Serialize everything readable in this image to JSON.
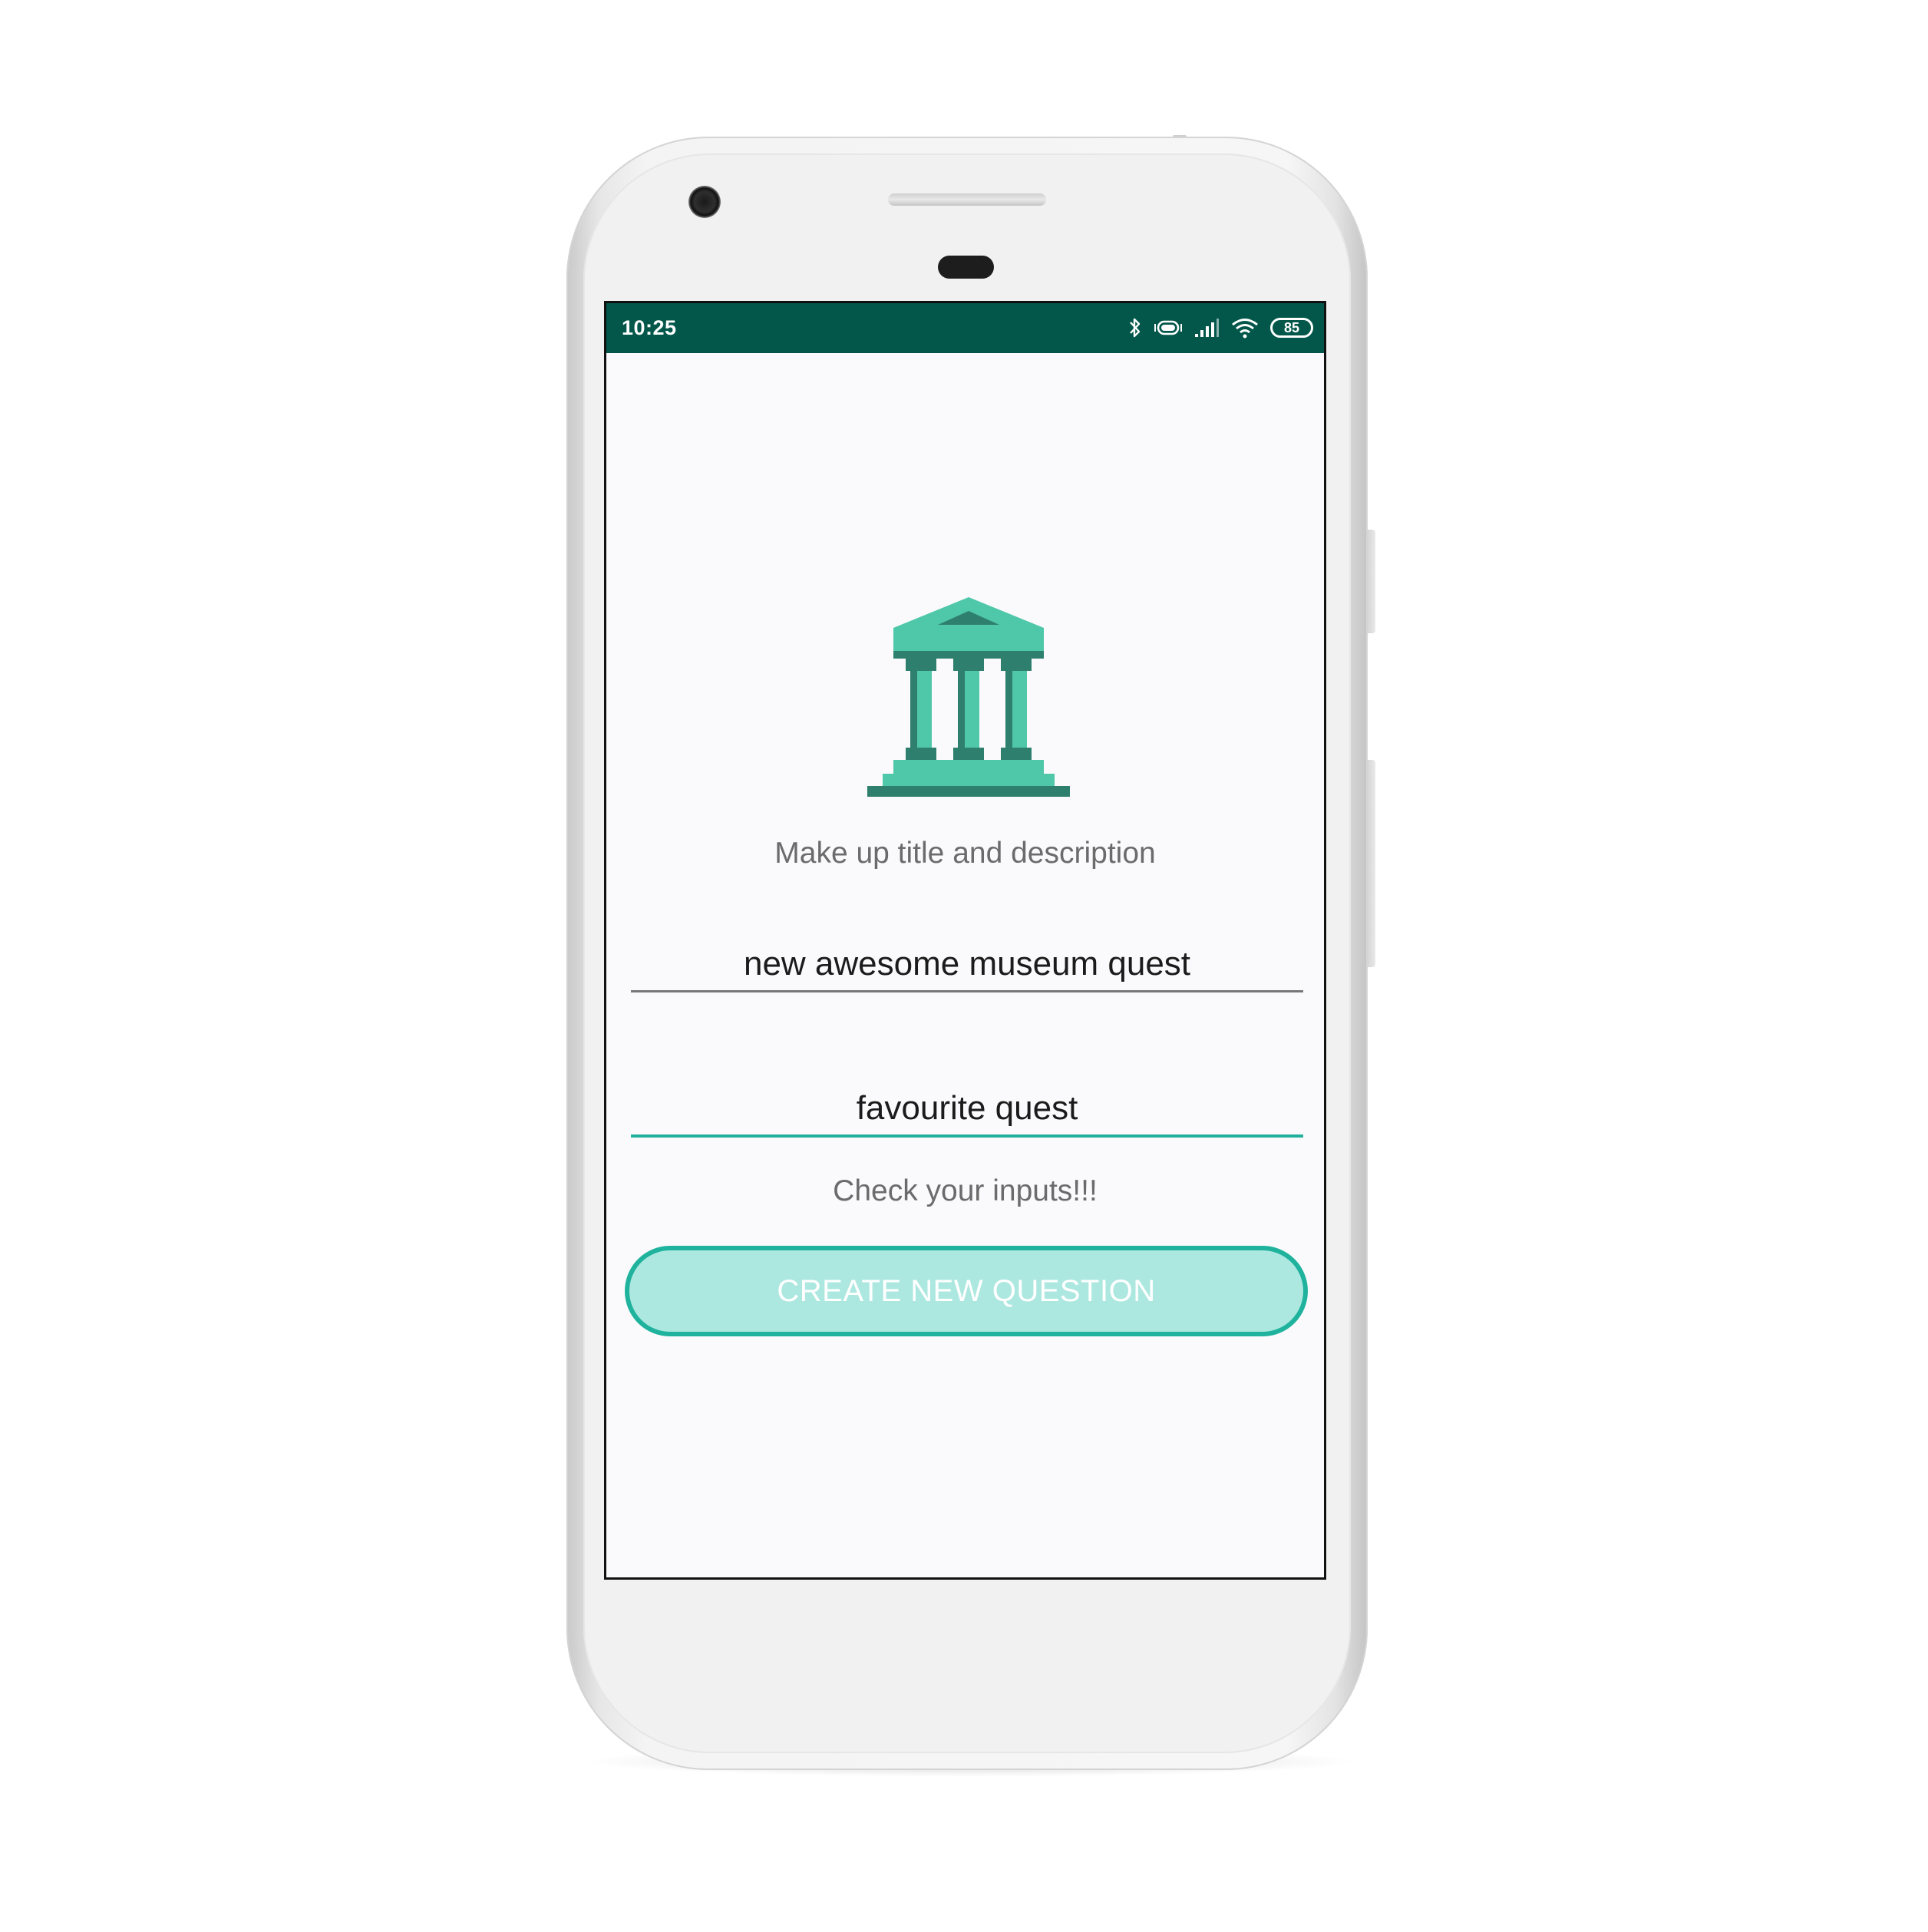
{
  "status_bar": {
    "time": "10:25",
    "battery_level": "85",
    "icons": [
      "bluetooth-icon",
      "vibrate-icon",
      "signal-icon",
      "wifi-icon",
      "battery-icon"
    ]
  },
  "main": {
    "illustration": "museum-icon",
    "subtitle": "Make up title and description",
    "title_field": {
      "value": "new awesome museum quest"
    },
    "description_field": {
      "value": "favourite quest"
    },
    "error_message": "Check your inputs!!!",
    "create_button_label": "CREATE NEW QUESTION"
  },
  "colors": {
    "status_bar": "#02574a",
    "accent": "#1fb39d",
    "button_fill": "#ade8e0",
    "museum_primary": "#4fc7a9",
    "museum_dark": "#2e7f6e",
    "background": "#fafafc"
  }
}
